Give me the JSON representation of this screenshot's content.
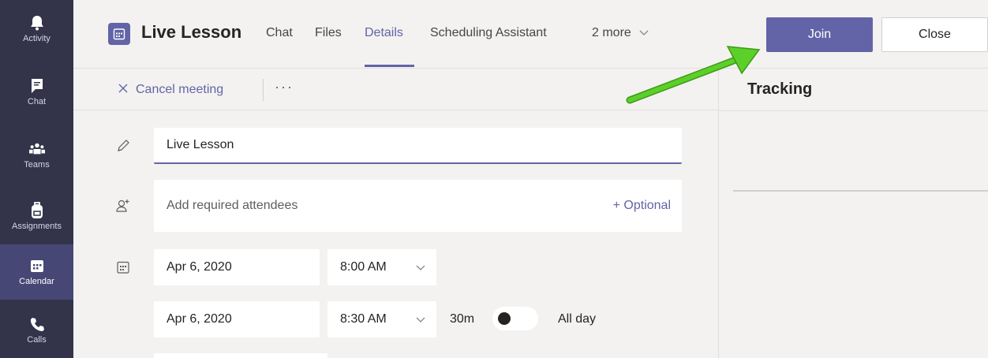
{
  "rail": {
    "items": [
      {
        "label": "Activity",
        "icon": "bell-icon"
      },
      {
        "label": "Chat",
        "icon": "chat-icon"
      },
      {
        "label": "Teams",
        "icon": "teams-icon"
      },
      {
        "label": "Assignments",
        "icon": "backpack-icon"
      },
      {
        "label": "Calendar",
        "icon": "calendar-icon",
        "active": true
      },
      {
        "label": "Calls",
        "icon": "phone-icon"
      }
    ]
  },
  "header": {
    "title": "Live Lesson",
    "tabs": [
      "Chat",
      "Files",
      "Details",
      "Scheduling Assistant",
      "2 more"
    ],
    "active_tab": "Details",
    "join_label": "Join",
    "close_label": "Close"
  },
  "toolbar": {
    "cancel_label": "Cancel meeting",
    "more_label": "···"
  },
  "tracking": {
    "title": "Tracking"
  },
  "form": {
    "title_value": "Live Lesson",
    "attendees_placeholder": "Add required attendees",
    "optional_label": "+ Optional",
    "start_date": "Apr 6, 2020",
    "start_time": "8:00 AM",
    "end_date": "Apr 6, 2020",
    "end_time": "8:30 AM",
    "duration": "30m",
    "allday_label": "All day",
    "allday_on": false
  },
  "colors": {
    "accent": "#6264a7",
    "rail_bg": "#33344a",
    "rail_active": "#464775",
    "arrow": "#5bd02a"
  }
}
